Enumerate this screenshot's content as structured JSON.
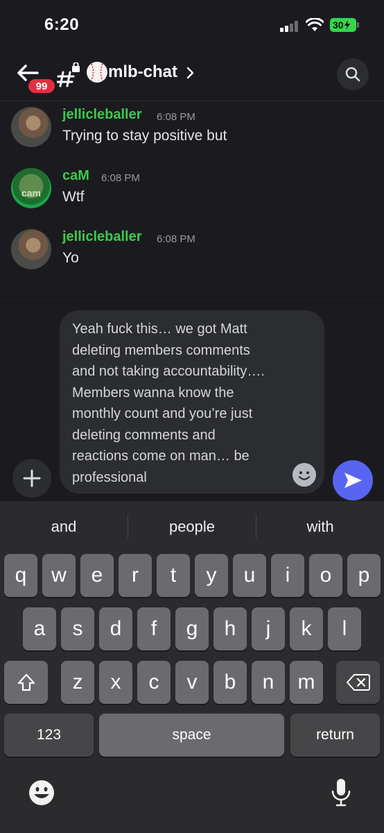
{
  "status_bar": {
    "time": "6:20",
    "battery": "30"
  },
  "header": {
    "badge_count": "99",
    "channel_name": "mlb-chat"
  },
  "messages": [
    {
      "author": "jellicleballer",
      "time": "6:08 PM",
      "text": "Trying to stay positive but"
    },
    {
      "author": "caM",
      "time": "6:08 PM",
      "text": "Wtf"
    },
    {
      "author": "jellicleballer",
      "time": "6:08 PM",
      "text": "Yo"
    }
  ],
  "avatar_cam_label": "cam",
  "composer": {
    "lines": [
      "Yeah fuck this… we got Matt",
      "deleting members comments",
      "and not taking accountability….",
      "Members wanna know the",
      "monthly count and you’re just",
      "deleting comments and",
      "reactions come on man… be",
      "professional"
    ]
  },
  "keyboard": {
    "suggestions": [
      "and",
      "people",
      "with"
    ],
    "row1": [
      "q",
      "w",
      "e",
      "r",
      "t",
      "y",
      "u",
      "i",
      "o",
      "p"
    ],
    "row2": [
      "a",
      "s",
      "d",
      "f",
      "g",
      "h",
      "j",
      "k",
      "l"
    ],
    "row3": [
      "z",
      "x",
      "c",
      "v",
      "b",
      "n",
      "m"
    ],
    "numbers_label": "123",
    "space_label": "space",
    "return_label": "return"
  },
  "colors": {
    "accent": "#5865f2",
    "username": "#3ec94c",
    "badge": "#e0303d"
  }
}
